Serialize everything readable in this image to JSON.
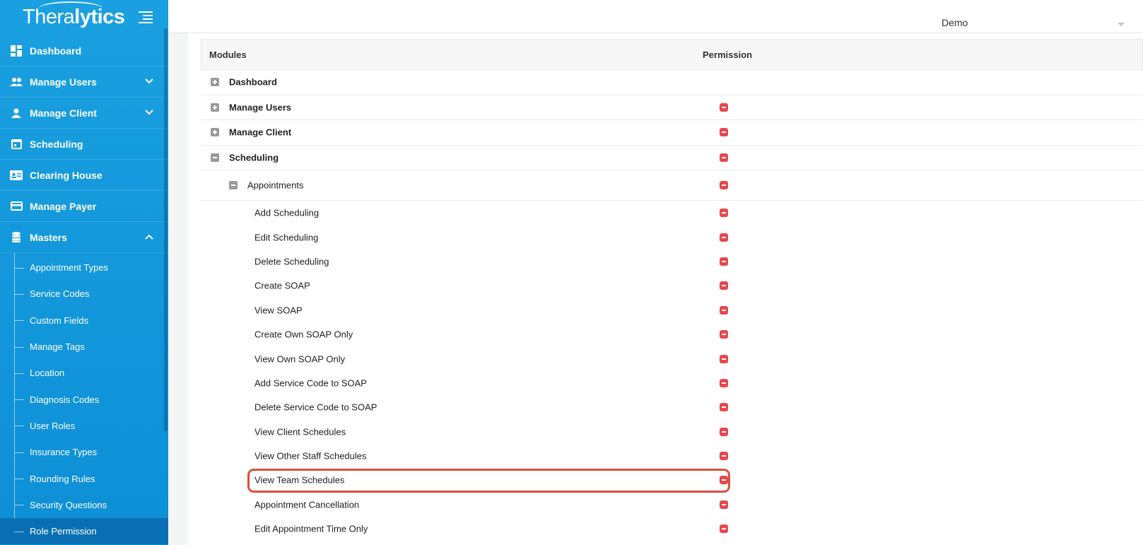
{
  "brand": {
    "name_part1": "Thera",
    "name_part2": "lytics"
  },
  "sidebar": {
    "items": [
      {
        "label": "Dashboard",
        "icon": "dashboard-icon"
      },
      {
        "label": "Manage Users",
        "icon": "users-icon",
        "expandable": true
      },
      {
        "label": "Manage Client",
        "icon": "user-icon",
        "expandable": true
      },
      {
        "label": "Scheduling",
        "icon": "calendar-icon"
      },
      {
        "label": "Clearing House",
        "icon": "id-card-icon"
      },
      {
        "label": "Manage Payer",
        "icon": "payer-icon"
      },
      {
        "label": "Masters",
        "icon": "database-icon",
        "expanded": true
      }
    ],
    "masters_sub": [
      "Appointment Types",
      "Service Codes",
      "Custom Fields",
      "Manage Tags",
      "Location",
      "Diagnosis Codes",
      "User Roles",
      "Insurance Types",
      "Rounding Rules",
      "Security Questions",
      "Role Permission"
    ],
    "active_sub": "Role Permission"
  },
  "topbar": {
    "user": "Demo"
  },
  "table": {
    "headers": {
      "modules": "Modules",
      "permission": "Permission"
    },
    "modules": [
      {
        "label": "Dashboard",
        "expanded": false,
        "permission": ""
      },
      {
        "label": "Manage Users",
        "expanded": false,
        "permission": "denied"
      },
      {
        "label": "Manage Client",
        "expanded": false,
        "permission": "denied"
      },
      {
        "label": "Scheduling",
        "expanded": true,
        "permission": "denied"
      }
    ],
    "submodule": {
      "label": "Appointments",
      "expanded": true,
      "permission": "denied"
    },
    "actions": [
      "Add Scheduling",
      "Edit Scheduling",
      "Delete Scheduling",
      "Create SOAP",
      "View SOAP",
      "Create Own SOAP Only",
      "View Own SOAP Only",
      "Add Service Code to SOAP",
      "Delete Service Code to SOAP",
      "View Client Schedules",
      "View Other Staff Schedules",
      "View Team Schedules",
      "Appointment Cancellation",
      "Edit Appointment Time Only"
    ],
    "highlighted_action": "View Team Schedules"
  },
  "colors": {
    "sidebar": "#1aa0e0",
    "deny": "#e8474d",
    "highlight": "#d9503a"
  }
}
